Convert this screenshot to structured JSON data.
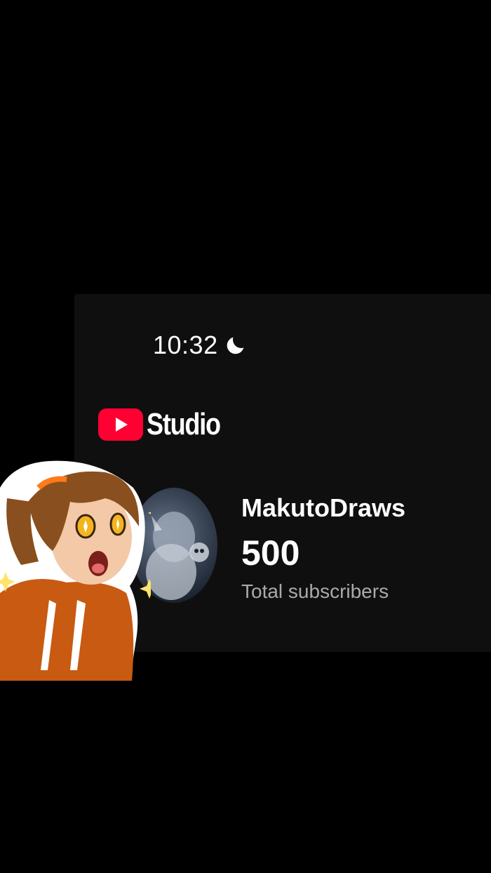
{
  "status": {
    "time": "10:32",
    "moon_icon": "moon-icon"
  },
  "app": {
    "logo_icon": "youtube-play-icon",
    "logo_text": "Studio"
  },
  "channel": {
    "name": "MakutoDraws",
    "subscriber_count": "500",
    "subscriber_label": "Total subscribers",
    "avatar": "channel-avatar"
  },
  "overlay": {
    "sticker": "cartoon-girl-sticker"
  },
  "colors": {
    "brand_red": "#ff0033",
    "panel_bg": "#0f0f0f",
    "muted_text": "#aaaaaa",
    "hoodie": "#c85a12"
  }
}
